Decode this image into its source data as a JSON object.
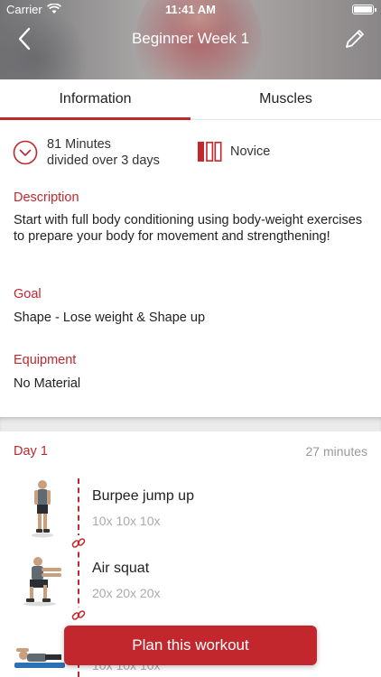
{
  "status": {
    "carrier": "Carrier",
    "time": "11:41 AM"
  },
  "nav": {
    "title": "Beginner Week 1"
  },
  "tabs": [
    {
      "label": "Information",
      "active": true
    },
    {
      "label": "Muscles",
      "active": false
    }
  ],
  "summary": {
    "duration_line1": "81 Minutes",
    "duration_line2": "divided over 3 days",
    "level": "Novice"
  },
  "sections": {
    "description": {
      "heading": "Description",
      "text": "Start with full body conditioning using body-weight exercises to prepare your body for movement and strengthening!"
    },
    "goal": {
      "heading": "Goal",
      "text": "Shape - Lose weight & Shape up"
    },
    "equipment": {
      "heading": "Equipment",
      "text": "No Material"
    }
  },
  "day": {
    "title": "Day 1",
    "minutes": "27 minutes",
    "exercises": [
      {
        "name": "Burpee jump up",
        "reps": "10x 10x 10x"
      },
      {
        "name": "Air squat",
        "reps": "20x 20x 20x"
      },
      {
        "name": "",
        "reps": "10x 10x 10x"
      }
    ]
  },
  "cta": {
    "label": "Plan this workout"
  },
  "colors": {
    "accent": "#c1272d",
    "muted": "#999999"
  },
  "icons": [
    "back-chevron-icon",
    "edit-pencil-icon",
    "clock-icon",
    "difficulty-bars-icon",
    "link-chain-icon",
    "wifi-icon",
    "battery-icon"
  ]
}
